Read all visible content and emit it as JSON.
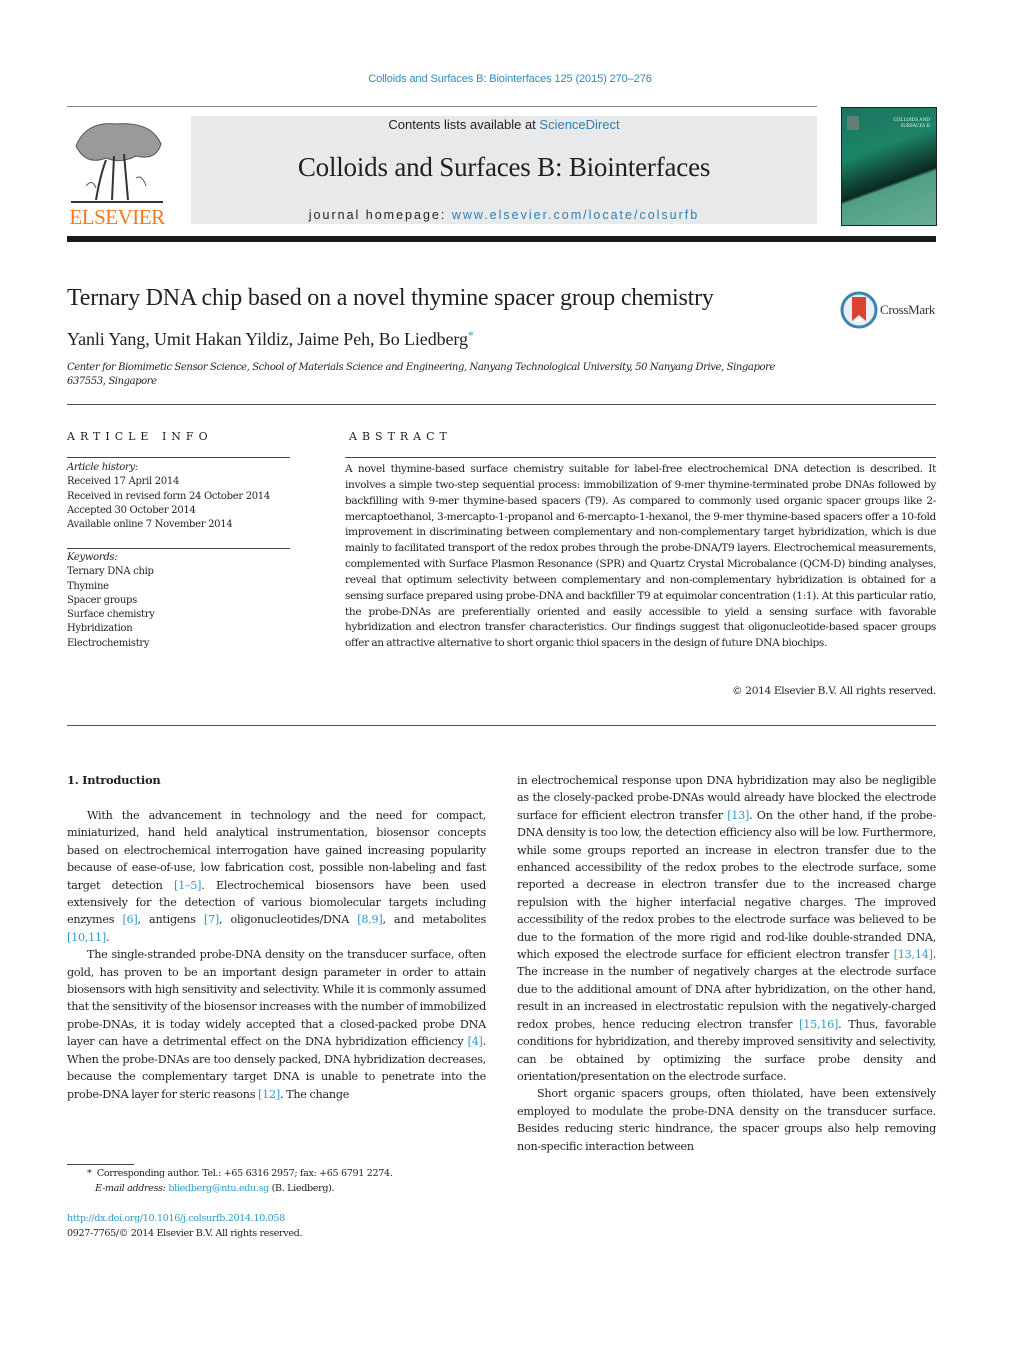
{
  "header": {
    "journal_reference": "Colloids and Surfaces B: Biointerfaces 125 (2015) 270–276",
    "publisher_logo_text": "ELSEVIER",
    "contents_prefix": "Contents lists available at ",
    "contents_link": "ScienceDirect",
    "journal_title": "Colloids and Surfaces B: Biointerfaces",
    "homepage_prefix": "journal homepage: ",
    "homepage_link": "www.elsevier.com/locate/colsurfb",
    "cover_title_line1": "COLLOIDS AND",
    "cover_title_line2": "SURFACES B"
  },
  "article": {
    "title": "Ternary DNA chip based on a novel thymine spacer group chemistry",
    "crossmark_label": "CrossMark",
    "authors": "Yanli Yang, Umit Hakan Yildiz, Jaime Peh, Bo Liedberg",
    "corresponding_marker": "*",
    "affiliation": "Center for Biomimetic Sensor Science, School of Materials Science and Engineering, Nanyang Technological University, 50 Nanyang Drive, Singapore 637553, Singapore"
  },
  "article_info": {
    "heading": "ARTICLE INFO",
    "history_label": "Article history:",
    "history": [
      "Received 17 April 2014",
      "Received in revised form 24 October 2014",
      "Accepted 30 October 2014",
      "Available online 7 November 2014"
    ],
    "keywords_label": "Keywords:",
    "keywords": [
      "Ternary DNA chip",
      "Thymine",
      "Spacer groups",
      "Surface chemistry",
      "Hybridization",
      "Electrochemistry"
    ]
  },
  "abstract": {
    "heading": "ABSTRACT",
    "text": "A novel thymine-based surface chemistry suitable for label-free electrochemical DNA detection is described. It involves a simple two-step sequential process: immobilization of 9-mer thymine-terminated probe DNAs followed by backfilling with 9-mer thymine-based spacers (T9). As compared to commonly used organic spacer groups like 2-mercaptoethanol, 3-mercapto-1-propanol and 6-mercapto-1-hexanol, the 9-mer thymine-based spacers offer a 10-fold improvement in discriminating between complementary and non-complementary target hybridization, which is due mainly to facilitated transport of the redox probes through the probe-DNA/T9 layers. Electrochemical measurements, complemented with Surface Plasmon Resonance (SPR) and Quartz Crystal Microbalance (QCM-D) binding analyses, reveal that optimum selectivity between complementary and non-complementary hybridization is obtained for a sensing surface prepared using probe-DNA and backfiller T9 at equimolar concentration (1:1). At this particular ratio, the probe-DNAs are preferentially oriented and easily accessible to yield a sensing surface with favorable hybridization and electron transfer characteristics. Our findings suggest that oligonucleotide-based spacer groups offer an attractive alternative to short organic thiol spacers in the design of future DNA biochips.",
    "copyright": "© 2014 Elsevier B.V. All rights reserved."
  },
  "body": {
    "section_heading": "1.  Introduction",
    "p1": {
      "a": "With the advancement in technology and the need for compact, miniaturized, hand held analytical instrumentation, biosensor concepts based on electrochemical interrogation have gained increasing popularity because of ease-of-use, low fabrication cost, possible non-labeling and fast target detection ",
      "c1": "[1–5]",
      "b": ". Electrochemical biosensors have been used extensively for the detection of various biomolecular targets including enzymes ",
      "c2": "[6]",
      "c": ", antigens ",
      "c3": "[7]",
      "d": ", oligonucleotides/DNA ",
      "c4": "[8,9]",
      "e": ", and metabolites ",
      "c5": "[10,11]",
      "f": "."
    },
    "p2": {
      "a": "The single-stranded probe-DNA density on the transducer surface, often gold, has proven to be an important design parameter in order to attain biosensors with high sensitivity and selectivity. While it is commonly assumed that the sensitivity of the biosensor increases with the number of immobilized probe-DNAs, it is today widely accepted that a closed-packed probe DNA layer can have a detrimental effect on the DNA hybridization efficiency ",
      "c1": "[4]",
      "b": ". When the probe-DNAs are too densely packed, DNA hybridization decreases, because the complementary target DNA is unable to penetrate into the probe-DNA layer for steric reasons ",
      "c2": "[12]",
      "c": ". The change"
    },
    "p3": {
      "a": "in electrochemical response upon DNA hybridization may also be negligible as the closely-packed probe-DNAs would already have blocked the electrode surface for efficient electron transfer ",
      "c1": "[13]",
      "b": ". On the other hand, if the probe-DNA density is too low, the detection efficiency also will be low. Furthermore, while some groups reported an increase in electron transfer due to the enhanced accessibility of the redox probes to the electrode surface, some reported a decrease in electron transfer due to the increased charge repulsion with the higher interfacial negative charges. The improved accessibility of the redox probes to the electrode surface was believed to be due to the formation of the more rigid and rod-like double-stranded DNA, which exposed the electrode surface for efficient electron transfer ",
      "c2": "[13,14]",
      "c": ". The increase in the number of negatively charges at the electrode surface due to the additional amount of DNA after hybridization, on the other hand, result in an increased in electrostatic repulsion with the negatively-charged redox probes, hence reducing electron transfer ",
      "c3": "[15,16]",
      "d": ". Thus, favorable conditions for hybridization, and thereby improved sensitivity and selectivity, can be obtained by optimizing the surface probe density and orientation/presentation on the electrode surface."
    },
    "p4": "Short organic spacers groups, often thiolated, have been extensively employed to modulate the probe-DNA density on the transducer surface. Besides reducing steric hindrance, the spacer groups also help removing non-specific interaction between"
  },
  "footnote": {
    "marker": "*",
    "corresponding": "Corresponding author. Tel.: +65 6316 2957; fax: +65 6791 2274.",
    "email_label": "E-mail address:",
    "email": "bliedberg@ntu.edu.sg",
    "email_suffix": " (B. Liedberg).",
    "doi": "http://dx.doi.org/10.1016/j.colsurfb.2014.10.058",
    "issn_copyright": "0927-7765/© 2014 Elsevier B.V. All rights reserved."
  },
  "colors": {
    "link": "#2f9ac7",
    "elsevier_orange": "#f47920",
    "banner_gray": "#e8e9ea",
    "cover_green": "#1c8466"
  }
}
